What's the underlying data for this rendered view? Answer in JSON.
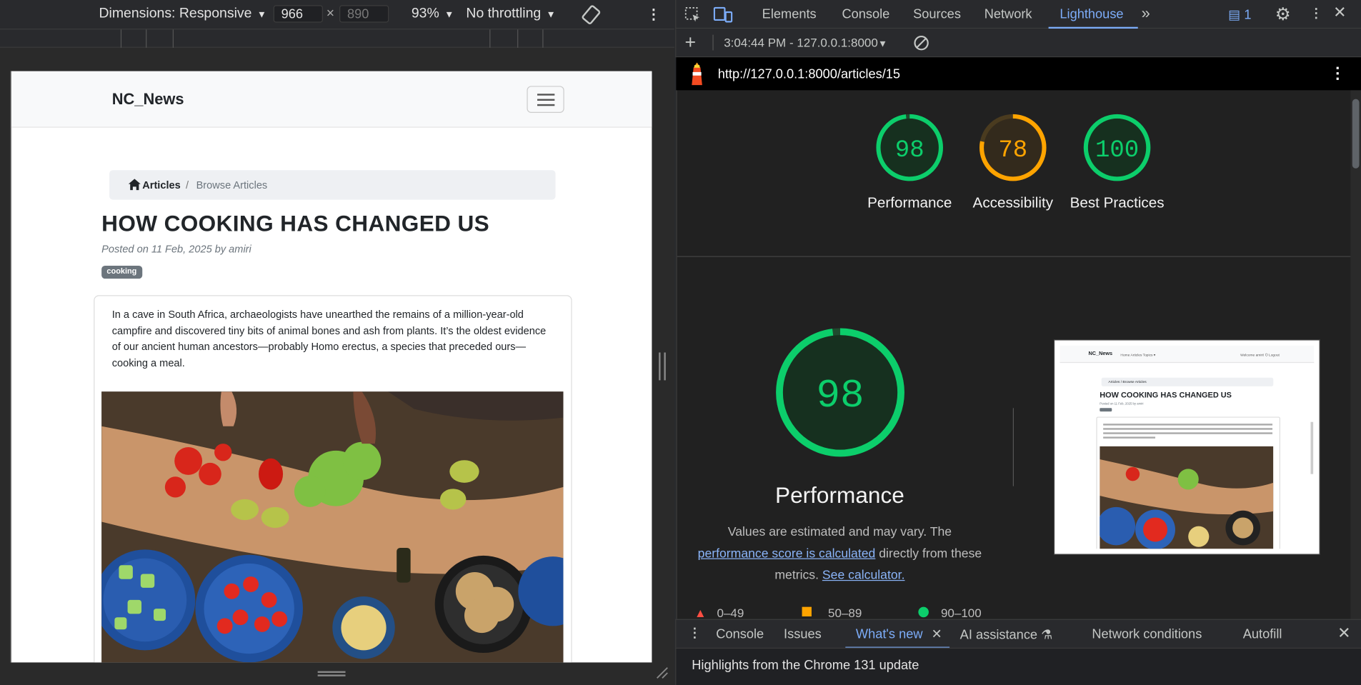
{
  "device_toolbar": {
    "dimensions_label": "Dimensions: Responsive",
    "width": "966",
    "height_placeholder": "890",
    "times": "×",
    "zoom": "93%",
    "throttling": "No throttling"
  },
  "page": {
    "brand": "NC_News",
    "breadcrumb": {
      "first": "Articles",
      "separator": "/",
      "second": "Browse Articles"
    },
    "title": "HOW COOKING HAS CHANGED US",
    "posted": "Posted on 11 Feb, 2025 by amiri",
    "tag": "cooking",
    "body": "In a cave in South Africa, archaeologists have unearthed the remains of a million-year-old campfire and discovered tiny bits of animal bones and ash from plants. It’s the oldest evidence of our ancient human ancestors—probably Homo erectus, a species that preceded ours—cooking a meal."
  },
  "devtools": {
    "tabs": [
      "Elements",
      "Console",
      "Sources",
      "Network",
      "Lighthouse"
    ],
    "active_tab": "Lighthouse",
    "more": "»",
    "issues_count": "1",
    "report_selector": "3:04:44 PM - 127.0.0.1:8000",
    "url": "http://127.0.0.1:8000/articles/15",
    "colors": {
      "pass": "#0cce6b",
      "average": "#ffa400",
      "fail": "#ff4e42",
      "accent": "#7cacf8"
    }
  },
  "lighthouse": {
    "scores": [
      {
        "label": "Performance",
        "score": 98,
        "level": "pass"
      },
      {
        "label": "Accessibility",
        "score": 78,
        "level": "average"
      },
      {
        "label": "Best Practices",
        "score": 100,
        "level": "pass"
      }
    ],
    "performance": {
      "score": 98,
      "title": "Performance",
      "desc_pre": "Values are estimated and may vary. The",
      "desc_link": "performance score is calculated",
      "desc_mid": "directly from these metrics.",
      "desc_link2": "See calculator."
    },
    "legend": {
      "fail": "0–49",
      "average": "50–89",
      "pass": "90–100"
    },
    "thumbnail": {
      "brand": "NC_News",
      "nav": "Home  Articles  Topics ▾",
      "right": "Welcome amiri!   ⏻ Logout",
      "crumb": "Articles  /  Browse Articles",
      "title": "HOW COOKING HAS CHANGED US",
      "posted": "Posted on 11 Feb, 2025 by amiri"
    }
  },
  "drawer": {
    "tabs": [
      "Console",
      "Issues",
      "What's new",
      "AI assistance",
      "Network conditions",
      "Autofill"
    ],
    "active_tab": "What's new",
    "message": "Highlights from the Chrome 131 update"
  }
}
